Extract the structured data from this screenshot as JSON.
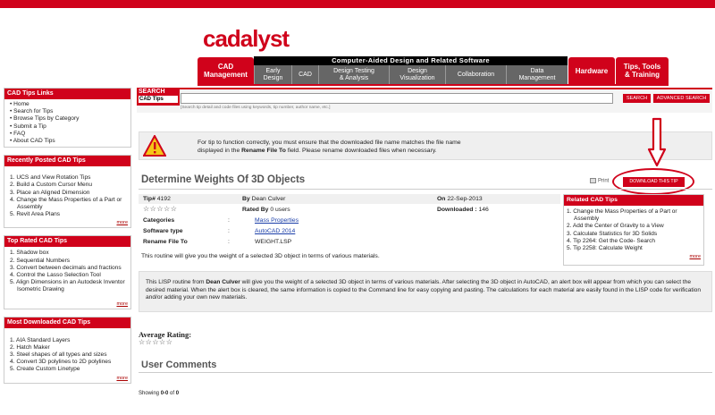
{
  "header": {
    "logo": "cadalyst",
    "tagline": "Computer-Aided Design and Related Software",
    "nav": {
      "cad_management": [
        "CAD",
        "Management"
      ],
      "sub_items": [
        [
          "Early",
          "Design"
        ],
        [
          "CAD"
        ],
        [
          "Design Testing",
          "& Analysis"
        ],
        [
          "Design",
          "Visualization"
        ],
        [
          "Collaboration"
        ],
        [
          "Data",
          "Management"
        ]
      ],
      "hardware": "Hardware",
      "tips_tools": [
        "Tips, Tools",
        "& Training"
      ]
    }
  },
  "sidebar": {
    "links": {
      "title": "CAD Tips Links",
      "items": [
        "Home",
        "Search for Tips",
        "Browse Tips by Category",
        "Submit a Tip",
        "FAQ",
        "About CAD Tips"
      ]
    },
    "recent": {
      "title": "Recently Posted CAD Tips",
      "items": [
        "UCS and View Rotation Tips",
        "Build a Custom Cursor Menu",
        "Place an Aligned Dimension",
        "Change the Mass Properties of a Part or Assembly",
        "Revit Area Plans"
      ],
      "more": "more"
    },
    "top_rated": {
      "title": "Top Rated CAD Tips",
      "items": [
        "Shadow box",
        "Sequential Numbers",
        "Convert between decimals and fractions",
        "Control the Lasso Selection Tool",
        "Align Dimensions in an Autodesk Inventor Isometric Drawing"
      ],
      "more": "more"
    },
    "most_downloaded": {
      "title": "Most Downloaded CAD Tips",
      "items": [
        "AIA Standard Layers",
        "Hatch Maker",
        "Steel shapes of all types and sizes",
        "Convert 3D polylines to 2D polylines",
        "Create Custom Linetype"
      ],
      "more": "more"
    }
  },
  "search": {
    "label": "SEARCH",
    "sublabel": "CAD Tips",
    "value": "",
    "hint": "[Search tip detail and code files using keywords, tip number, author name, etc.]",
    "search_button": "SEARCH",
    "advanced_button": "ADVANCED SEARCH"
  },
  "notice": {
    "line1": "For tip to function correctly, you must ensure that the downloaded file name matches the file name",
    "line2_pre": "displayed in the ",
    "line2_bold": "Rename File To",
    "line2_post": " field. Please rename downloaded files when necessary."
  },
  "tip": {
    "title": "Determine Weights Of 3D Objects",
    "print": "Print",
    "download_button": "DOWNLOAD THIS TIP",
    "tip_label": "Tip#",
    "tip_number": "4192",
    "by_label": "By",
    "author": "Dean Culver",
    "on_label": "On",
    "date": "22-Sep-2013",
    "stars": "☆☆☆☆☆",
    "rated_label": "Rated By",
    "rated_value": "0 users",
    "downloaded_label": "Downloaded :",
    "downloaded_value": "146",
    "categories_label": "Categories",
    "categories_value": "Mass Properties",
    "software_label": "Software type",
    "software_value": "AutoCAD 2014",
    "rename_label": "Rename File To",
    "rename_value": "WEIGHT.LSP",
    "colon": ":",
    "short_desc": "This routine will give you the weight of a selected 3D object in terms of various materials.",
    "long_desc_pre": "This LISP routine from ",
    "long_desc_author": "Dean Culver",
    "long_desc_post": " will give you the weight of a selected 3D object in terms of various materials. After selecting the 3D object in AutoCAD, an alert box will appear from which you can select the desired material. When the alert box is cleared, the same information is copied to the Command line for easy copying and pasting. The calculations for each material are easily found in the LISP code for verification and/or adding your own new materials."
  },
  "related": {
    "title": "Related CAD Tips",
    "items": [
      "Change the Mass Properties of a Part or Assembly",
      "Add the Center of Gravity to a View",
      "Calculate Statistics for 3D Solids",
      "Tip 2264: Get the Code- Search",
      "Tip 2258: Calculate Weight"
    ],
    "more": "more"
  },
  "ratings": {
    "average_label": "Average Rating:",
    "stars": "☆☆☆☆☆"
  },
  "comments": {
    "title": "User Comments",
    "showing_pre": "Showing ",
    "showing_range": "0-0",
    "showing_mid": " of ",
    "showing_total": "0"
  },
  "colors": {
    "brand_red": "#d0021b",
    "nav_gray": "#666666",
    "link_blue": "#1a3ea8"
  },
  "icons": [
    "warning-icon",
    "arrow-down-icon",
    "print-icon"
  ]
}
